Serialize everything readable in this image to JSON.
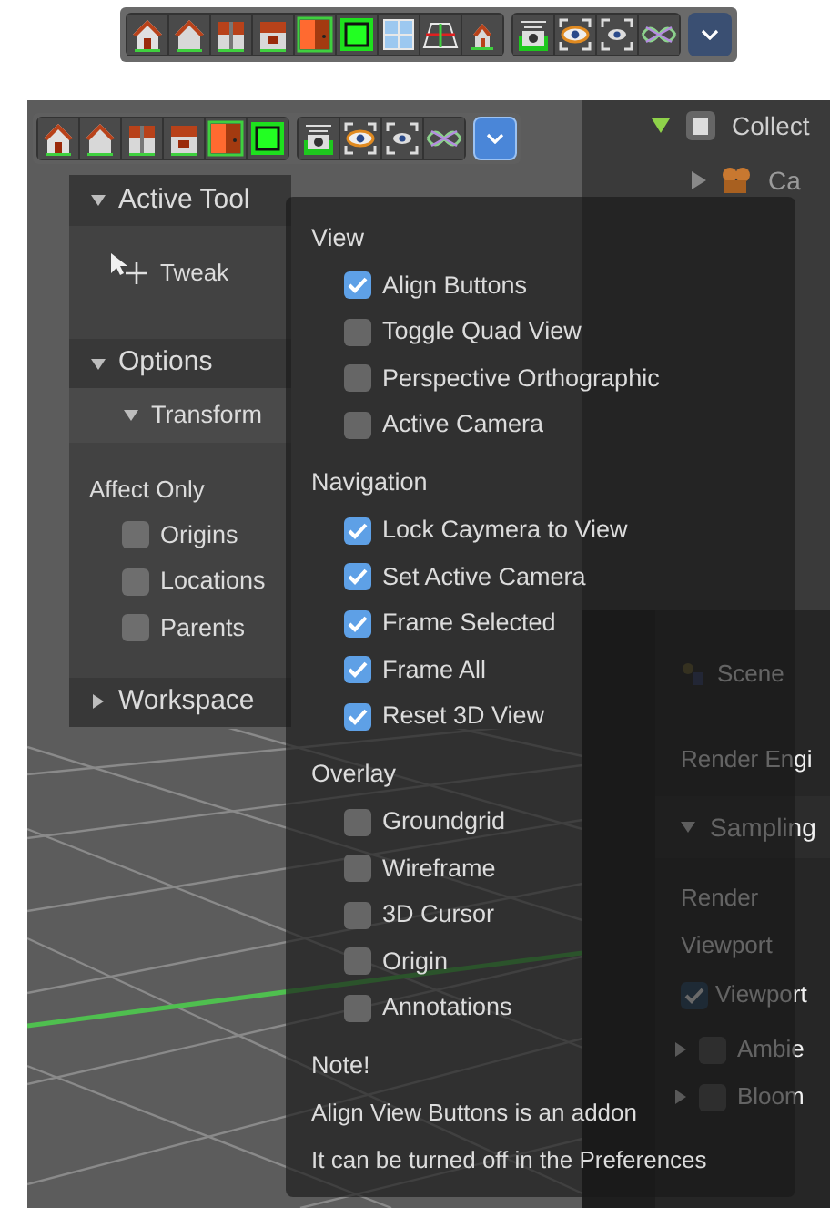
{
  "header_toolbar": {
    "menu_open": false
  },
  "viewport_toolbar": {
    "menu_open": true
  },
  "sidebar": {
    "active_tool": {
      "title": "Active Tool",
      "expanded": true,
      "tool": "Tweak"
    },
    "options": {
      "title": "Options",
      "expanded": true,
      "subpanel": {
        "title": "Transform",
        "expanded": true
      },
      "group_label": "Affect Only",
      "checkboxes": [
        {
          "label": "Origins",
          "checked": false
        },
        {
          "label": "Locations",
          "checked": false
        },
        {
          "label": "Parents",
          "checked": false
        }
      ]
    },
    "workspace": {
      "title": "Workspace",
      "expanded": false
    }
  },
  "outliner": {
    "items": [
      {
        "label": "Collect",
        "expanded": true,
        "children": [
          {
            "label": "Ca",
            "expanded": false
          }
        ]
      }
    ]
  },
  "properties": {
    "scene_label": "Scene",
    "render_engine_label": "Render Engi",
    "sampling": {
      "title": "Sampling",
      "expanded": true
    },
    "render_label": "Render",
    "viewport_label": "Viewport",
    "toggles": [
      {
        "label": "Viewport",
        "checked": true
      }
    ],
    "effects": [
      {
        "label": "Ambie",
        "checked": false,
        "expanded": false
      },
      {
        "label": "Bloom",
        "checked": false,
        "expanded": false
      }
    ]
  },
  "popup": {
    "sections": [
      {
        "title": "View",
        "items": [
          {
            "label": "Align Buttons",
            "checked": true
          },
          {
            "label": "Toggle Quad View",
            "checked": false
          },
          {
            "label": "Perspective Orthographic",
            "checked": false
          },
          {
            "label": "Active Camera",
            "checked": false
          }
        ]
      },
      {
        "title": "Navigation",
        "items": [
          {
            "label": "Lock Caymera to View",
            "checked": true
          },
          {
            "label": "Set Active Camera",
            "checked": true
          },
          {
            "label": "Frame Selected",
            "checked": true
          },
          {
            "label": "Frame All",
            "checked": true
          },
          {
            "label": "Reset 3D View",
            "checked": true
          }
        ]
      },
      {
        "title": "Overlay",
        "items": [
          {
            "label": "Groundgrid",
            "checked": false
          },
          {
            "label": "Wireframe",
            "checked": false
          },
          {
            "label": "3D Cursor",
            "checked": false
          },
          {
            "label": "Origin",
            "checked": false
          },
          {
            "label": "Annotations",
            "checked": false
          }
        ]
      }
    ],
    "note_title": "Note!",
    "note_lines": [
      "Align View Buttons is an addon",
      "It can be turned off in the Preferences"
    ]
  }
}
